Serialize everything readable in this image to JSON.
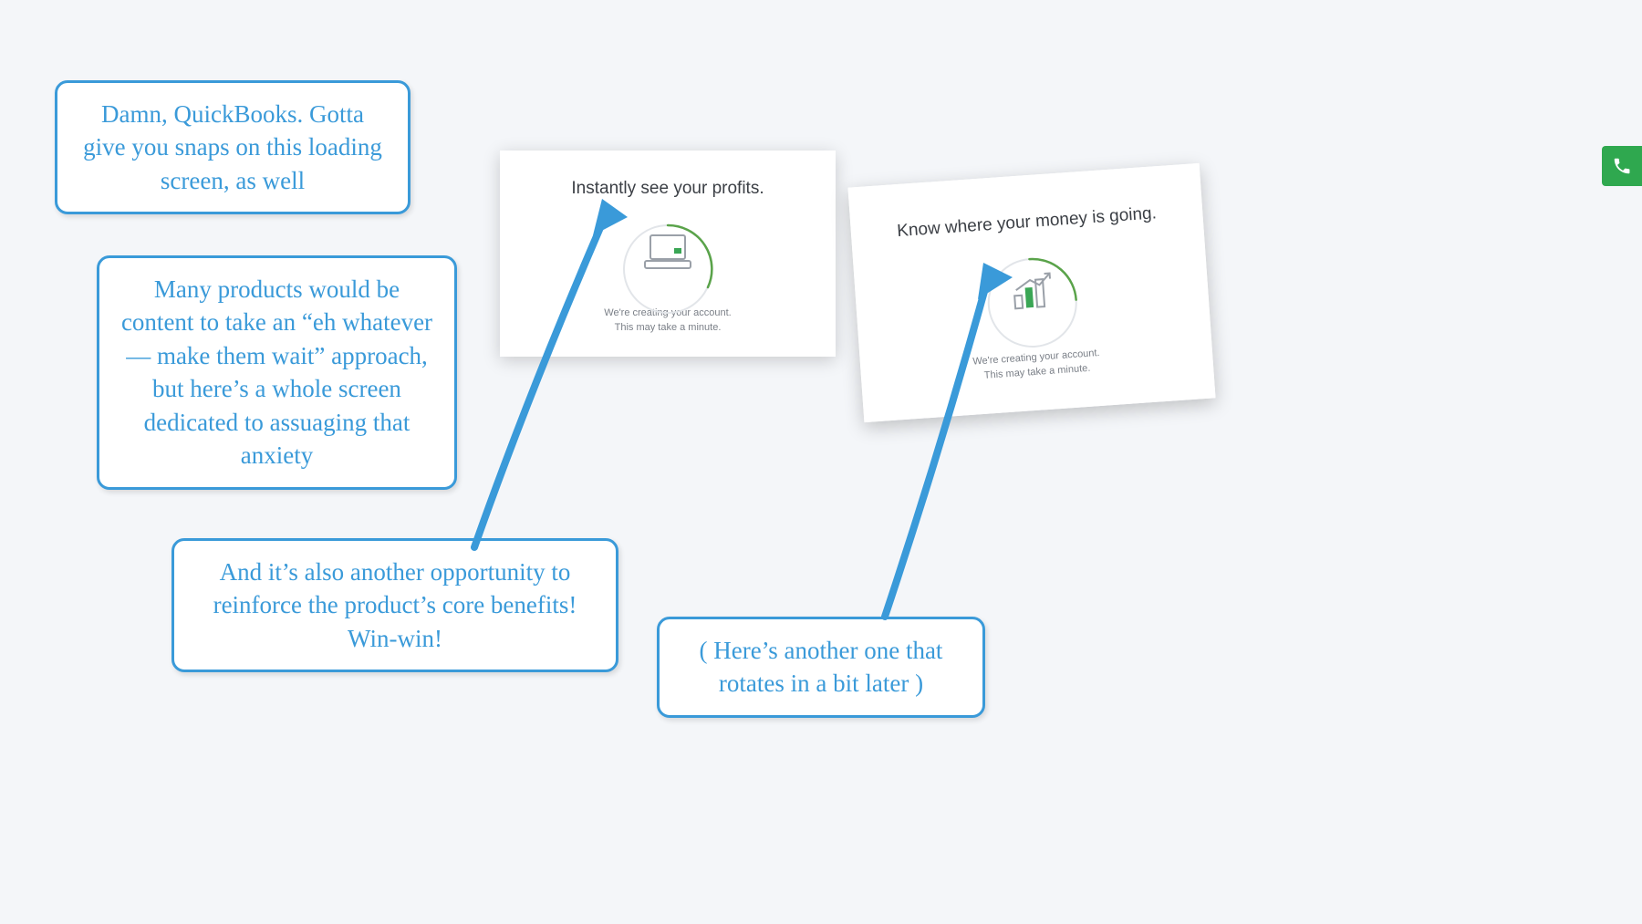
{
  "annotations": {
    "a1": "Damn, QuickBooks. Gotta give you snaps on this loading screen, as well",
    "a2": "Many products would be content to take an “eh whatever — make them wait” approach, but here’s a whole screen dedicated to assuaging that anxiety",
    "a3": "And it’s also another opportunity to reinforce the product’s core benefits! Win-win!",
    "a4": "( Here’s another one that rotates in a bit later )"
  },
  "cards": {
    "card1": {
      "heading": "Instantly see your profits.",
      "sub1": "We're creating your account.",
      "sub2": "This may take a minute."
    },
    "card2": {
      "heading": "Know where your money is going.",
      "sub1": "We're creating your account.",
      "sub2": "This may take a minute."
    }
  },
  "colors": {
    "annotation_blue": "#3a9ad9",
    "brand_green": "#2fa84f"
  }
}
